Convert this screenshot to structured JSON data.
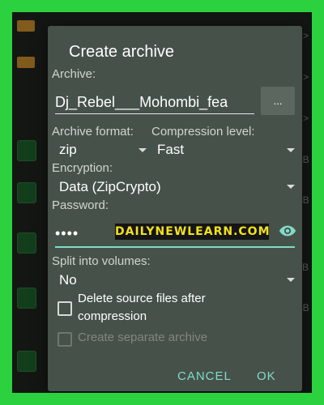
{
  "background": {
    "meta": [
      "iR>",
      "iR>",
      "iR>",
      "5KB",
      "0KB",
      "MB",
      "7KB"
    ]
  },
  "dialog": {
    "title": "Create archive",
    "archive_label": "Archive:",
    "archive_value": "Dj_Rebel___Mohombi_fea",
    "browse_label": "...",
    "format_label": "Archive format:",
    "format_value": "zip",
    "compression_label": "Compression level:",
    "compression_value": "Fast",
    "encryption_label": "Encryption:",
    "encryption_value": "Data (ZipCrypto)",
    "password_label": "Password:",
    "password_mask": "••••",
    "watermark": "DAILYNEWLEARN.COM",
    "split_label": "Split into volumes:",
    "split_value": "No",
    "delete_label_line1": "Delete source files after",
    "delete_label_line2": "compression",
    "separate_label": "Create separate archive",
    "cancel_label": "CANCEL",
    "ok_label": "OK"
  },
  "colors": {
    "frame": "#2bd13f",
    "dialog": "#46514a",
    "accent": "#7fdcc7",
    "watermark_text": "#f2e21c"
  },
  "icons": {
    "password_toggle": "eye-icon",
    "dropdown": "caret-down-icon",
    "file": "file-icon",
    "folder": "folder-icon"
  }
}
